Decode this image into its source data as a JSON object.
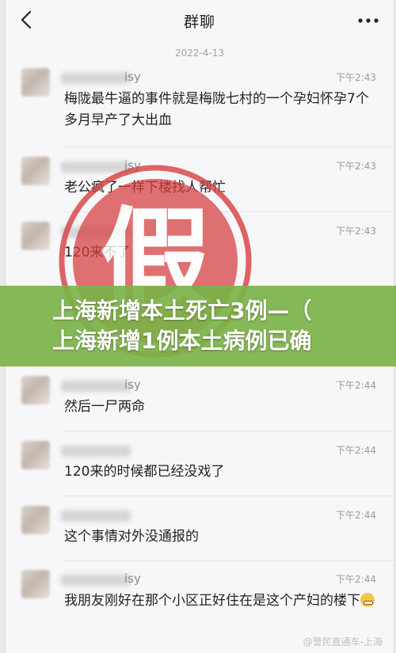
{
  "header": {
    "title": "群聊",
    "back_icon": "chevron-left-icon",
    "more_icon": "more-dots-icon"
  },
  "date_separator": "2022-4-13",
  "stamp": {
    "label": "假",
    "color": "#d64040"
  },
  "banner": {
    "color": "#7bb248",
    "line1": "上海新增本土死亡3例—（",
    "line2": "上海新增1例本土病例已确"
  },
  "messages": [
    {
      "name_suffix": "isy",
      "time": "下午2:43",
      "text": "梅陇最牛逼的事件就是梅陇七村的一个孕妇怀孕7个多月早产了大出血"
    },
    {
      "name_suffix": "isy",
      "time": "下午2:43",
      "text": "老公疯了一样下楼找人帮忙"
    },
    {
      "name_suffix": "",
      "time": "下午2:43",
      "text": "120来不了"
    },
    {
      "name_suffix": "isy",
      "time": "下午2:44",
      "text": "然后一尸两命"
    },
    {
      "name_suffix": "",
      "time": "下午2:44",
      "text": "120来的时候都已经没戏了"
    },
    {
      "name_suffix": "",
      "time": "下午2:44",
      "text": "这个事情对外没通报的"
    },
    {
      "name_suffix": "isy",
      "time": "下午2:44",
      "text": "我朋友刚好在那个小区正好住在是这个产妇的楼下"
    }
  ],
  "watermark": "@警民直通车-上海"
}
